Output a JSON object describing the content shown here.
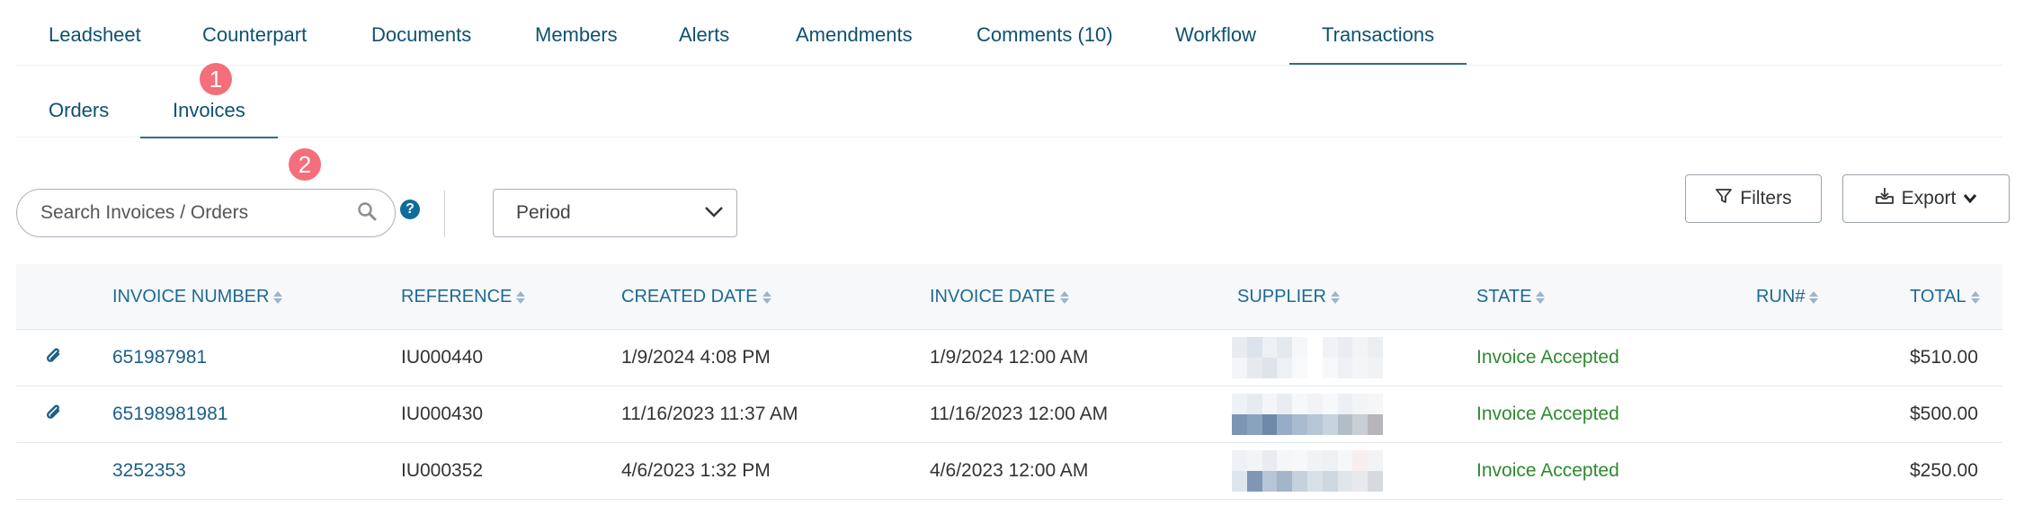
{
  "tabs": [
    {
      "label": "Leadsheet"
    },
    {
      "label": "Counterpart"
    },
    {
      "label": "Documents"
    },
    {
      "label": "Members"
    },
    {
      "label": "Alerts"
    },
    {
      "label": "Amendments"
    },
    {
      "label": "Comments (10)"
    },
    {
      "label": "Workflow"
    },
    {
      "label": "Transactions"
    }
  ],
  "active_tab": "Transactions",
  "subtabs": [
    {
      "label": "Orders"
    },
    {
      "label": "Invoices"
    }
  ],
  "active_subtab": "Invoices",
  "badges": {
    "one": "1",
    "two": "2"
  },
  "toolbar": {
    "search_placeholder": "Search Invoices / Orders",
    "help_label": "?",
    "period_label": "Period",
    "filters_label": "Filters",
    "export_label": "Export"
  },
  "table": {
    "columns": [
      "INVOICE NUMBER",
      "REFERENCE",
      "CREATED DATE",
      "INVOICE DATE",
      "SUPPLIER",
      "STATE",
      "RUN#",
      "TOTAL"
    ],
    "rows": [
      {
        "attachment": true,
        "invoice_number": "651987981",
        "reference": "IU000440",
        "created_date": "1/9/2024 4:08 PM",
        "invoice_date": "1/9/2024 12:00 AM",
        "state": "Invoice Accepted",
        "run": "",
        "total": "$510.00"
      },
      {
        "attachment": true,
        "invoice_number": "65198981981",
        "reference": "IU000430",
        "created_date": "11/16/2023 11:37 AM",
        "invoice_date": "11/16/2023 12:00 AM",
        "state": "Invoice Accepted",
        "run": "",
        "total": "$500.00"
      },
      {
        "attachment": false,
        "invoice_number": "3252353",
        "reference": "IU000352",
        "created_date": "4/6/2023 1:32 PM",
        "invoice_date": "4/6/2023 12:00 AM",
        "state": "Invoice Accepted",
        "run": "",
        "total": "$250.00"
      }
    ]
  },
  "colors": {
    "link": "#1d5f8a",
    "header_text": "#1d6a94",
    "state_accepted": "#2f8a2f",
    "badge": "#f46e7c",
    "help": "#0e6d9a",
    "tab_underline": "#2c6e8e"
  },
  "icons": {
    "search": "search-icon",
    "help": "help-icon",
    "period": "chevron-down-icon",
    "filters": "filter-icon",
    "export": "download-icon",
    "attachment": "paperclip-icon",
    "sort": "sort-icon"
  }
}
